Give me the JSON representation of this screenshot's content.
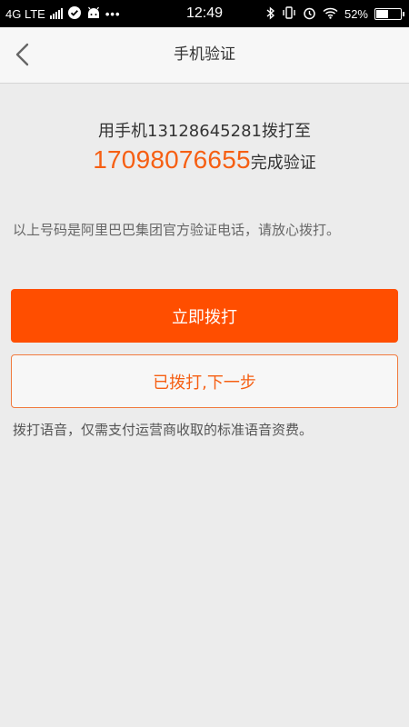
{
  "status_bar": {
    "network": "4G LTE",
    "time": "12:49",
    "battery_percent": "52%",
    "battery_level": 0.52,
    "left_icons": [
      "signal-icon",
      "check-circle-icon",
      "android-icon",
      "more-dots-icon"
    ],
    "right_icons": [
      "bluetooth-icon",
      "vibrate-icon",
      "alarm-icon",
      "wifi-icon",
      "battery-icon"
    ]
  },
  "nav": {
    "title": "手机验证",
    "back_icon": "chevron-left-icon"
  },
  "content": {
    "line1": "用手机13128645281拨打至",
    "target_number": "17098076655",
    "line2_suffix": "完成验证",
    "notice": "以上号码是阿里巴巴集团官方验证电话，请放心拨打。"
  },
  "buttons": {
    "call_now": "立即拨打",
    "next_step": "已拨打,下一步"
  },
  "footnote": "拨打语音，仅需支付运营商收取的标准语音资费。",
  "colors": {
    "accent": "#ff4e00",
    "accent_text": "#f65f13",
    "background": "#ececec"
  }
}
